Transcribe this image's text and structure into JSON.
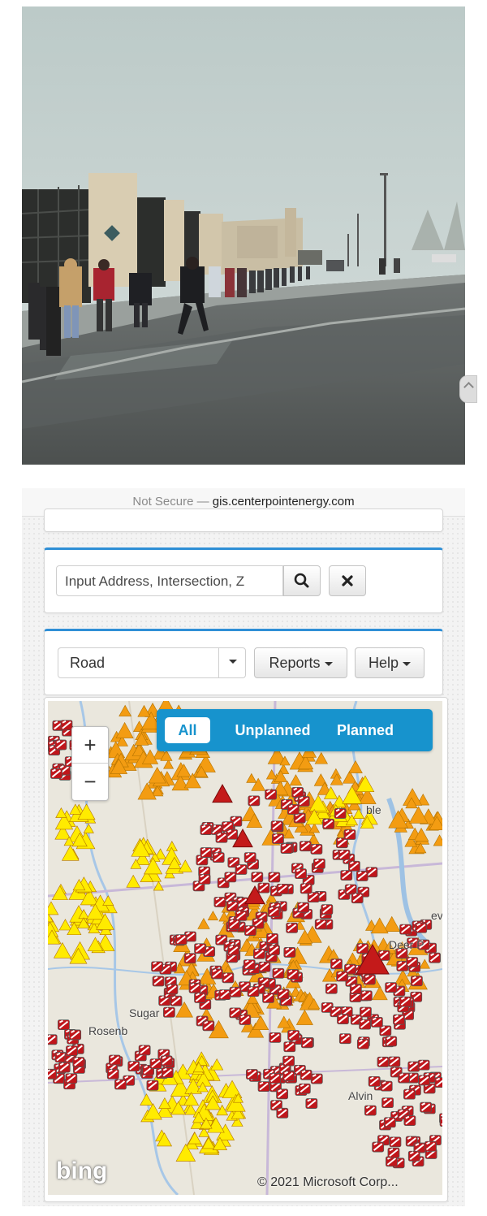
{
  "colors": {
    "accent": "#2f8fd6",
    "filter_bar": "#1793cd",
    "outage_orange": "#f39c12",
    "outage_yellow": "#ffeb00",
    "outage_red": "#c0161b",
    "crew_icon": "#ffffff"
  },
  "browser": {
    "security_label": "Not Secure —",
    "url": "gis.centerpointenergy.com"
  },
  "search": {
    "placeholder": "Input Address, Intersection, Z",
    "search_icon": "search-icon",
    "clear_icon": "close-icon"
  },
  "toolbar": {
    "basemap_selected": "Road",
    "reports_label": "Reports",
    "help_label": "Help"
  },
  "map": {
    "zoom_in": "+",
    "zoom_out": "−",
    "filters": [
      {
        "label": "All",
        "active": true
      },
      {
        "label": "Unplanned",
        "active": false
      },
      {
        "label": "Planned",
        "active": false
      }
    ],
    "place_labels": [
      "Sugar",
      "Rosenb",
      "Alvin",
      "Deer P",
      "ble",
      "ev"
    ],
    "logo": "bing",
    "copyright": "© 2021 Microsoft Corp..."
  }
}
